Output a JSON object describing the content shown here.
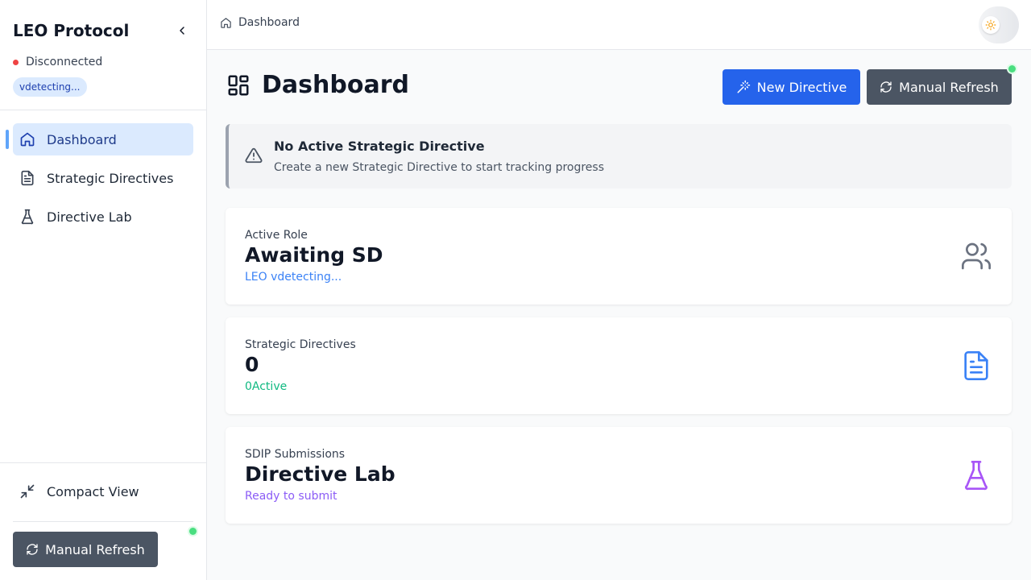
{
  "sidebar": {
    "brand": "LEO Protocol",
    "status": "Disconnected",
    "session_chip": "vdetecting...",
    "nav": [
      {
        "label": "Dashboard",
        "icon": "home-icon",
        "active": true
      },
      {
        "label": "Strategic Directives",
        "icon": "file-text-icon",
        "active": false
      },
      {
        "label": "Directive Lab",
        "icon": "flask-icon",
        "active": false
      }
    ],
    "compact_view_label": "Compact View",
    "refresh_label": "Manual Refresh"
  },
  "header": {
    "breadcrumb": "Dashboard",
    "theme_icon": "sun-icon"
  },
  "main": {
    "title": "Dashboard",
    "new_directive_label": "New Directive",
    "refresh_label": "Manual Refresh",
    "alert": {
      "title": "No Active Strategic Directive",
      "message": "Create a new Strategic Directive to start tracking progress"
    },
    "cards": [
      {
        "label": "Active Role",
        "value": "Awaiting SD",
        "sub": "LEO vdetecting...",
        "icon": "users-icon",
        "accent": "#3b82f6"
      },
      {
        "label": "Strategic Directives",
        "value": "0",
        "sub": "0Active",
        "icon": "file-text-icon",
        "accent": "#10b981"
      },
      {
        "label": "SDIP Submissions",
        "value": "Directive Lab",
        "sub": "Ready to submit",
        "icon": "flask-icon",
        "accent": "#8b5cf6"
      }
    ]
  },
  "colors": {
    "primary": "#2563eb",
    "dark_button": "#4b5563",
    "status_disconnected": "#ef4444",
    "online_dot": "#4ade80"
  }
}
